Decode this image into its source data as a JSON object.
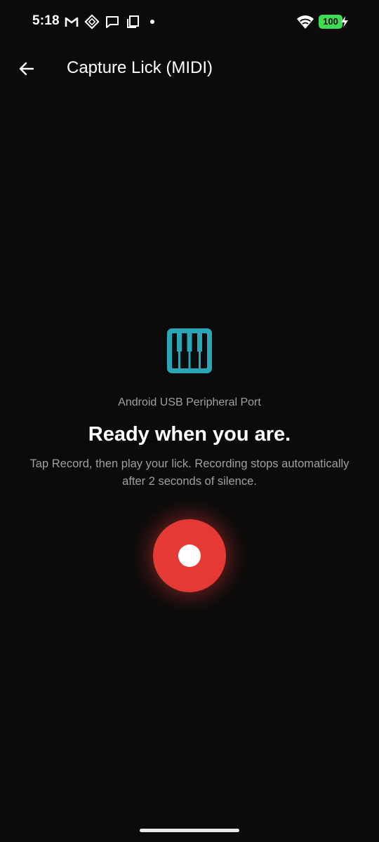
{
  "status_bar": {
    "time": "5:18",
    "battery_level": "100",
    "icons": [
      "gmail-icon",
      "app-diamond-icon",
      "message-icon",
      "copy-icon",
      "dot-icon",
      "wifi-icon",
      "battery-icon",
      "charging-bolt-icon"
    ]
  },
  "app_bar": {
    "title": "Capture Lick (MIDI)",
    "back_icon": "arrow-left-icon"
  },
  "content": {
    "icon": "piano-keys-icon",
    "port_name": "Android USB Peripheral Port",
    "headline": "Ready when you are.",
    "instructions": "Tap Record, then play your lick. Recording stops automatically after 2 seconds of silence."
  },
  "record_button": {
    "icon": "record-icon"
  },
  "colors": {
    "background": "#0b0b0b",
    "accent_teal": "#2ba6b6",
    "record_red": "#e53935",
    "battery_green": "#3ddc52",
    "secondary_text": "#a0a0a0"
  }
}
